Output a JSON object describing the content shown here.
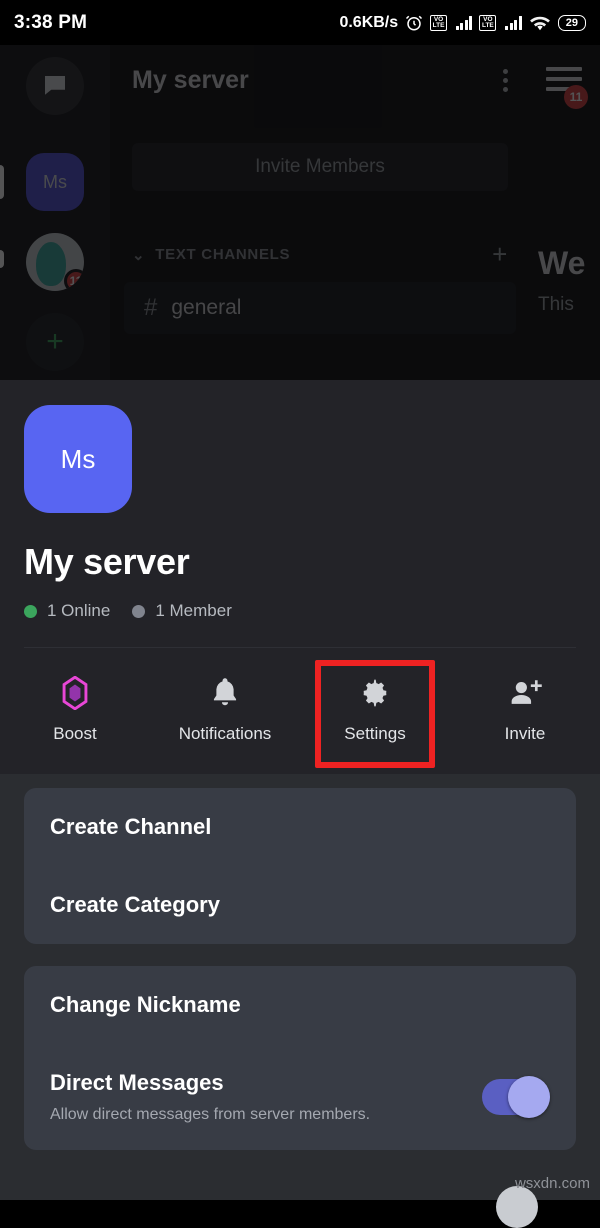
{
  "status_bar": {
    "time": "3:38 PM",
    "network_speed": "0.6KB/s",
    "alarm_icon": "alarm-clock-icon",
    "volte_label_1": "VO\nLTE",
    "volte_text_top": "VO",
    "volte_text_bottom": "LTE",
    "wifi_icon": "wifi-icon",
    "battery_percent": "29"
  },
  "backdrop": {
    "home_icon": "discord-home-icon",
    "server_rail": [
      {
        "label": "Ms",
        "type": "square"
      },
      {
        "label": "",
        "type": "circle",
        "badge": "11"
      }
    ],
    "add_server_label": "+",
    "channel_pane": {
      "title": "My server",
      "overflow_icon": "more-vertical-icon",
      "invite_button": "Invite Members",
      "category_label": "TEXT CHANNELS",
      "category_chevron": "chevron-down-icon",
      "add_channel_label": "+",
      "channel_hash": "#",
      "channel_name": "general"
    },
    "right_pane": {
      "welcome_partial": "We",
      "subtitle_partial": "This"
    },
    "members_icon": "hamburger-menu-icon",
    "members_badge": "11"
  },
  "sheet": {
    "server_initials": "Ms",
    "server_name": "My server",
    "online_text": "1 Online",
    "member_text": "1 Member",
    "online_color": "#3ba55d",
    "member_color": "#80848e",
    "actions": [
      {
        "label": "Boost",
        "icon": "boost-diamond-icon",
        "highlighted": false
      },
      {
        "label": "Notifications",
        "icon": "bell-icon",
        "highlighted": false
      },
      {
        "label": "Settings",
        "icon": "gear-icon",
        "highlighted": true
      },
      {
        "label": "Invite",
        "icon": "person-add-icon",
        "highlighted": false
      }
    ],
    "card_one": [
      {
        "title": "Create Channel"
      },
      {
        "title": "Create Category"
      }
    ],
    "card_two": [
      {
        "title": "Change Nickname"
      },
      {
        "title": "Direct Messages",
        "subtitle": "Allow direct messages from server members.",
        "toggle_on": true
      }
    ]
  },
  "annotation": {
    "highlight_color": "#ee2222",
    "target": "Settings"
  },
  "watermark": "wsxdn.com"
}
